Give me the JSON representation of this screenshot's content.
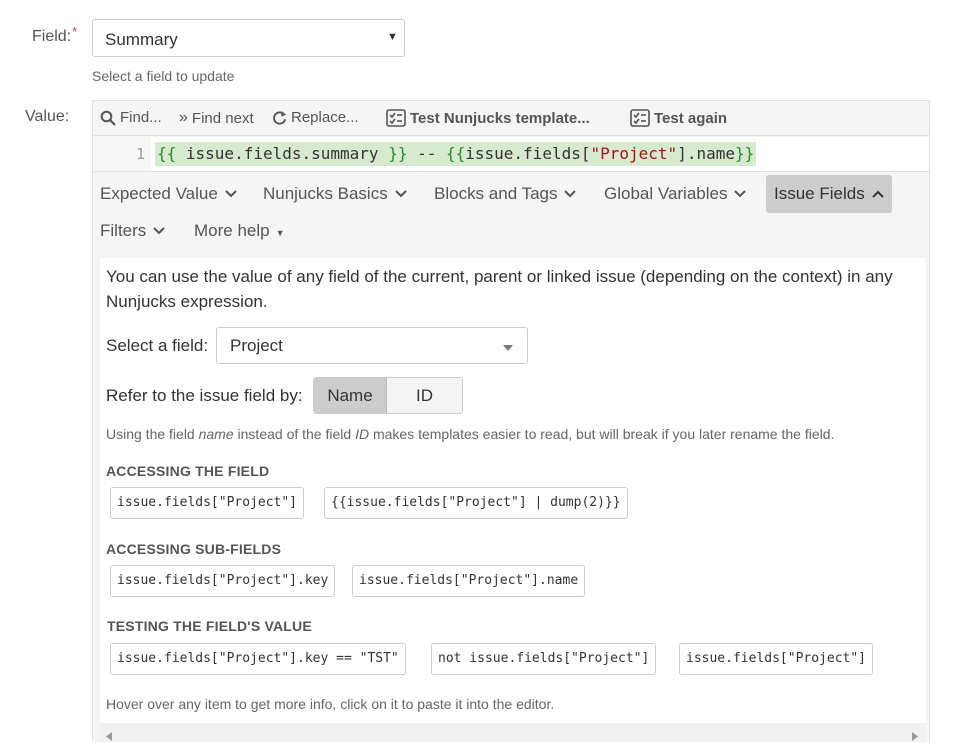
{
  "field": {
    "label": "Field:",
    "required_mark": "*",
    "selected": "Summary",
    "hint": "Select a field to update"
  },
  "value": {
    "label": "Value:"
  },
  "toolbar": {
    "find": "Find...",
    "find_next": "Find next",
    "replace": "Replace...",
    "test_template": "Test Nunjucks template...",
    "test_again": "Test again"
  },
  "editor": {
    "line_number": "1",
    "code": {
      "p1": "{{",
      "p2": " issue.fields.summary ",
      "p3": "}}",
      "p4": " -- ",
      "p5": "{{",
      "p6": "issue.fields[",
      "p7": "\"Project\"",
      "p8": "].name",
      "p9": "}}"
    }
  },
  "help_tabs": [
    {
      "label": "Expected Value"
    },
    {
      "label": "Nunjucks Basics"
    },
    {
      "label": "Blocks and Tags"
    },
    {
      "label": "Global Variables"
    },
    {
      "label": "Issue Fields"
    },
    {
      "label": "Filters"
    },
    {
      "label": "More help"
    }
  ],
  "panel": {
    "intro": "You can use the value of any field of the current, parent or linked issue (depending on the context) in any Nunjucks expression.",
    "select_label": "Select a field:",
    "select_value": "Project",
    "refer_label": "Refer to the issue field by:",
    "refer_options": [
      "Name",
      "ID"
    ],
    "note": {
      "a": "Using the field ",
      "b": "name",
      "c": " instead of the field ",
      "d": "ID",
      "e": " makes templates easier to read, but will break if you later rename the field."
    },
    "sections": [
      {
        "title": "ACCESSING THE FIELD",
        "chips": [
          "issue.fields[\"Project\"]",
          "{{issue.fields[\"Project\"] | dump(2)}}"
        ]
      },
      {
        "title": "ACCESSING SUB-FIELDS",
        "chips": [
          "issue.fields[\"Project\"].key",
          "issue.fields[\"Project\"].name"
        ]
      },
      {
        "title": "TESTING THE FIELD'S VALUE",
        "chips": [
          "issue.fields[\"Project\"].key == \"TST\"",
          "not issue.fields[\"Project\"]",
          "issue.fields[\"Project\"]"
        ]
      }
    ],
    "footer_hint": "Hover over any item to get more info, click on it to paste it into the editor."
  },
  "colors": {
    "required": "#d04437",
    "active_tab_bg": "#cccccc",
    "code_brace": "#2a8a2a",
    "code_string": "#aa1111",
    "code_highlight": "#d7ead0"
  }
}
